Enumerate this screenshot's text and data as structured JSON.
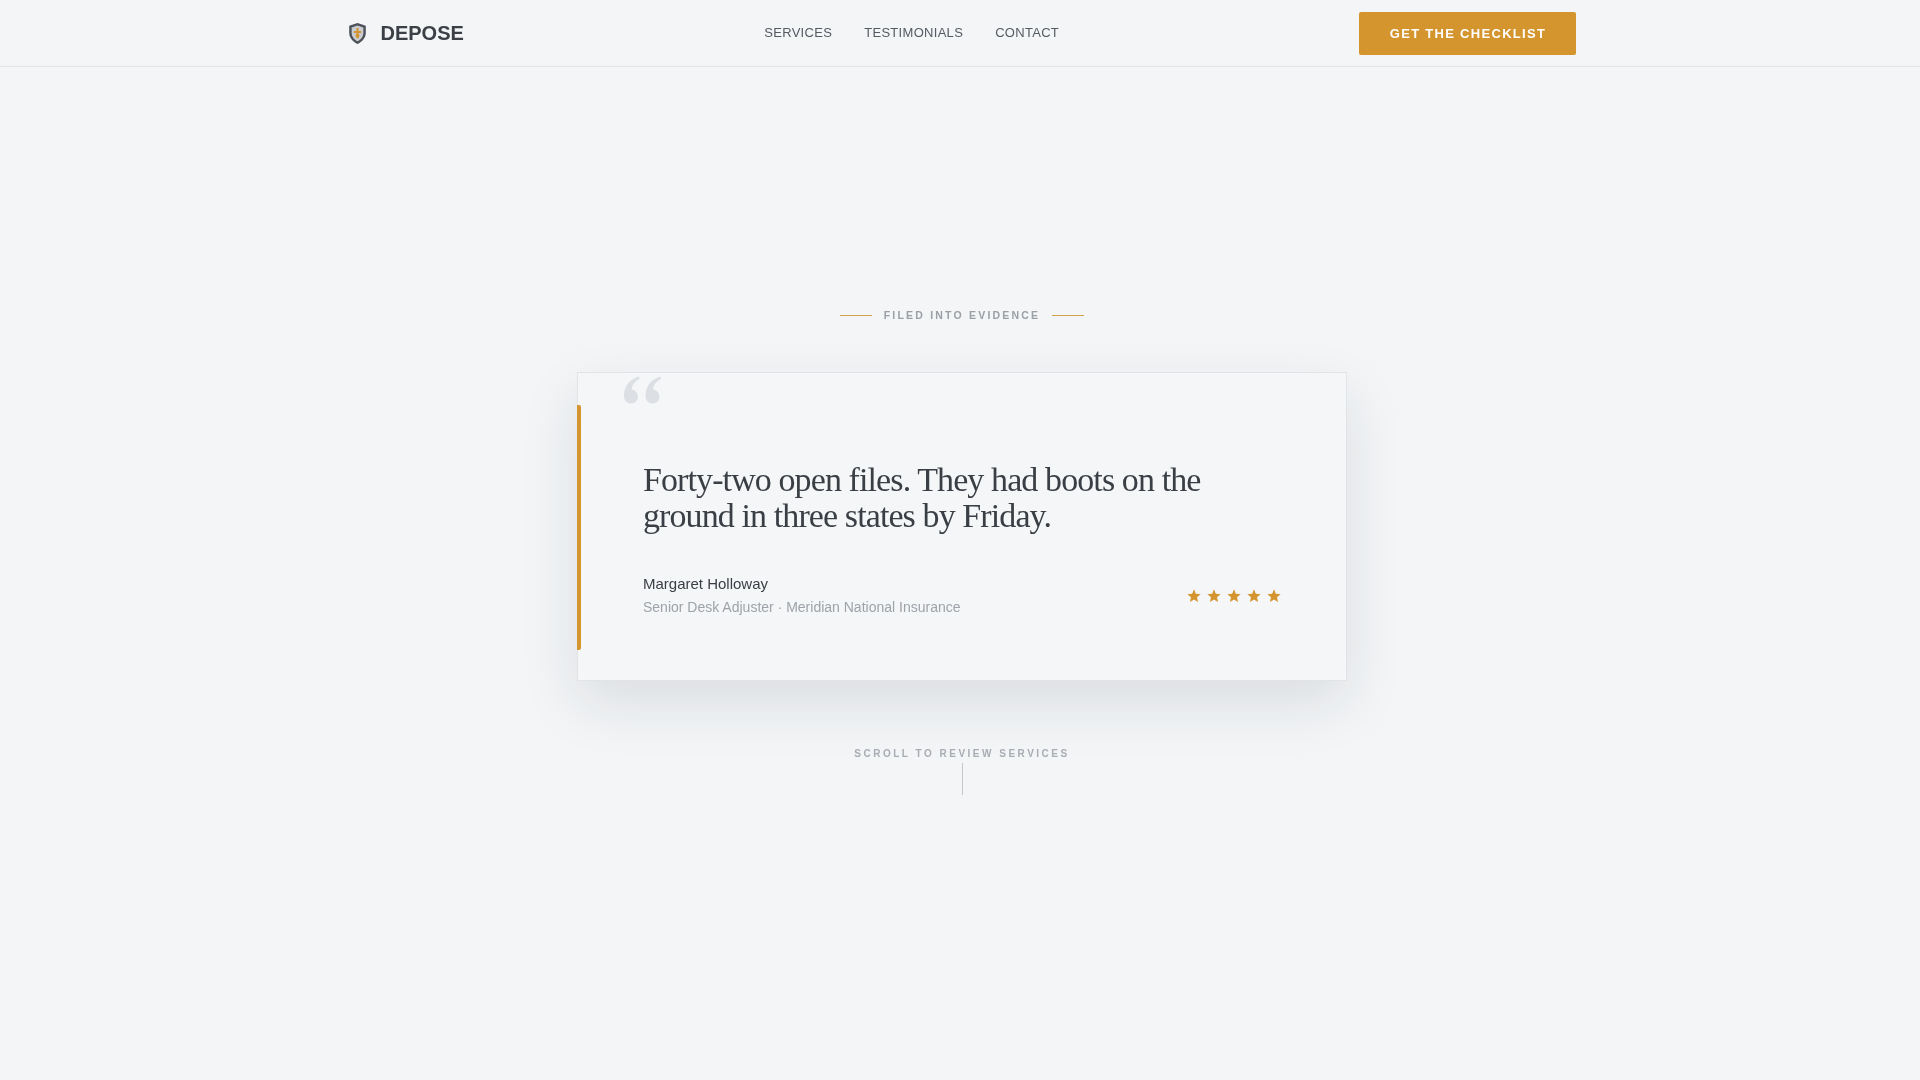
{
  "header": {
    "brand": "DEPOSE",
    "nav": [
      "SERVICES",
      "TESTIMONIALS",
      "CONTACT"
    ],
    "cta": "GET THE CHECKLIST"
  },
  "testimonial": {
    "eyebrow": "FILED INTO EVIDENCE",
    "quote": "Forty-two open files. They had boots on the ground in three states by Friday.",
    "author": "Margaret Holloway",
    "role": "Senior Desk Adjuster · Meridian National Insurance",
    "stars": 5
  },
  "scroll_hint": "SCROLL TO REVIEW SERVICES"
}
